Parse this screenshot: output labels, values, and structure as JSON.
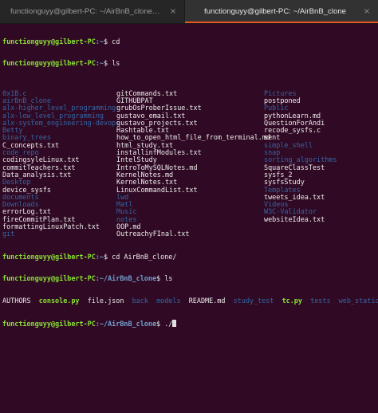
{
  "window": {
    "tabs": [
      {
        "label": "functionguyy@gilbert-PC: ~/AirBnB_clone/web_static/...",
        "close": "×"
      },
      {
        "label": "functionguyy@gilbert-PC: ~/AirBnB_clone",
        "close": "×"
      }
    ]
  },
  "colors": {
    "background": "#300a24",
    "prompt_user": "#8ae234",
    "prompt_path": "#729fcf",
    "directory": "#3465a4",
    "text": "#ececec"
  },
  "prompt": {
    "user_host": "functionguyy@gilbert-PC",
    "home_path": ":~",
    "clone_path": ":~/AirBnB_clone"
  },
  "commands": {
    "cd": "$ cd",
    "ls": "$ ls",
    "cd_clone": "$ cd AirBnB_clone/",
    "ls2": "$ ls",
    "run": "$ ./"
  },
  "home_listing": {
    "col1": [
      {
        "name": "0x1B.c",
        "type": "dir"
      },
      {
        "name": "airBnB_clone",
        "type": "dir"
      },
      {
        "name": "alx-higher_level_programming",
        "type": "dir"
      },
      {
        "name": "alx-low_level_programming",
        "type": "dir"
      },
      {
        "name": "alx-system_engineering-devops",
        "type": "dir"
      },
      {
        "name": "Betty",
        "type": "dir"
      },
      {
        "name": "binary_trees",
        "type": "dir"
      },
      {
        "name": "C_concepts.txt",
        "type": "file"
      },
      {
        "name": "code_repo",
        "type": "dir"
      },
      {
        "name": "codingsyleLinux.txt",
        "type": "file"
      },
      {
        "name": "commitTeachers.txt",
        "type": "file"
      },
      {
        "name": "Data_analysis.txt",
        "type": "file"
      },
      {
        "name": "Desktop",
        "type": "dir"
      },
      {
        "name": "device_sysfs",
        "type": "file"
      },
      {
        "name": "documents",
        "type": "dir"
      },
      {
        "name": "Downloads",
        "type": "dir"
      },
      {
        "name": "errorLog.txt",
        "type": "file"
      },
      {
        "name": "fireCommitPlan.txt",
        "type": "file"
      },
      {
        "name": "formattingLinuxPatch.txt",
        "type": "file"
      },
      {
        "name": "git",
        "type": "dir"
      }
    ],
    "col2": [
      {
        "name": "gitCommands.txt",
        "type": "file"
      },
      {
        "name": "GITHUBPAT",
        "type": "file"
      },
      {
        "name": "grubOsProberIssue.txt",
        "type": "file"
      },
      {
        "name": "gustavo_email.txt",
        "type": "file"
      },
      {
        "name": "gustavo_projects.txt",
        "type": "file"
      },
      {
        "name": "Hashtable.txt",
        "type": "file"
      },
      {
        "name": "how_to_open_html_file_from_terminal.md",
        "type": "file"
      },
      {
        "name": "html_study.txt",
        "type": "file"
      },
      {
        "name": "installinfModules.txt",
        "type": "file"
      },
      {
        "name": "IntelStudy",
        "type": "file"
      },
      {
        "name": "IntroToMySQLNotes.md",
        "type": "file"
      },
      {
        "name": "KernelNotes.md",
        "type": "file"
      },
      {
        "name": "KernelNotes.txt",
        "type": "file"
      },
      {
        "name": "LinuxCommandList.txt",
        "type": "file"
      },
      {
        "name": "lwd",
        "type": "dir"
      },
      {
        "name": "Matl",
        "type": "dir"
      },
      {
        "name": "Music",
        "type": "dir"
      },
      {
        "name": "notes",
        "type": "dir"
      },
      {
        "name": "OOP.md",
        "type": "file"
      },
      {
        "name": "OutreachyFInal.txt",
        "type": "file"
      }
    ],
    "col3": [
      {
        "name": "Pictures",
        "type": "dir"
      },
      {
        "name": "postponed",
        "type": "file"
      },
      {
        "name": "Public",
        "type": "dir"
      },
      {
        "name": "pythonLearn.md",
        "type": "file"
      },
      {
        "name": "QuestionForAndi",
        "type": "file"
      },
      {
        "name": "recode_sysfs.c",
        "type": "file"
      },
      {
        "name": "sent",
        "type": "file"
      },
      {
        "name": "simple_shell",
        "type": "dir"
      },
      {
        "name": "snap",
        "type": "dir"
      },
      {
        "name": "sorting_algorithms",
        "type": "dir"
      },
      {
        "name": "SquareClassTest",
        "type": "file"
      },
      {
        "name": "sysfs_2",
        "type": "file"
      },
      {
        "name": "sysfsStudy",
        "type": "file"
      },
      {
        "name": "Templates",
        "type": "dir"
      },
      {
        "name": "tweets_idea.txt",
        "type": "file"
      },
      {
        "name": "Videos",
        "type": "dir"
      },
      {
        "name": "W3C-Validator",
        "type": "dir"
      },
      {
        "name": "websiteIdea.txt",
        "type": "file"
      }
    ]
  },
  "clone_listing": [
    {
      "name": "AUTHORS",
      "type": "file"
    },
    {
      "name": "console.py",
      "type": "exec"
    },
    {
      "name": "file.json",
      "type": "file"
    },
    {
      "name": "back",
      "type": "dir"
    },
    {
      "name": "models",
      "type": "dir"
    },
    {
      "name": "README.md",
      "type": "file"
    },
    {
      "name": "study_test",
      "type": "dir"
    },
    {
      "name": "tc.py",
      "type": "exec"
    },
    {
      "name": "tests",
      "type": "dir"
    },
    {
      "name": "web_static",
      "type": "dir"
    }
  ]
}
